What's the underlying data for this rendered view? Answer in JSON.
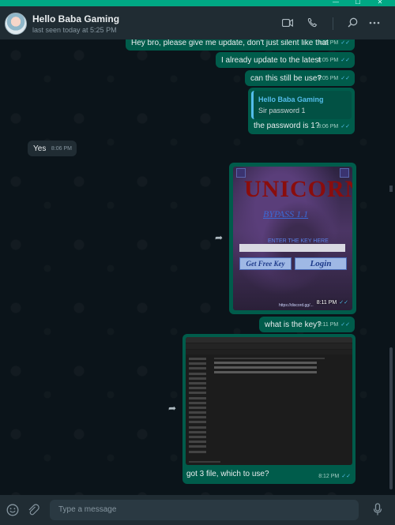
{
  "window": {
    "minimize_glyph": "—",
    "maximize_glyph": "☐",
    "close_glyph": "✕"
  },
  "header": {
    "contact_name": "Hello Baba Gaming",
    "status": "last seen today at 5:25 PM",
    "icons": [
      "video-call-icon",
      "voice-call-icon",
      "search-icon",
      "menu-icon"
    ]
  },
  "messages": [
    {
      "dir": "out",
      "text": "Hey bro, please give me update, don't just silent like that",
      "time": "8:05 PM"
    },
    {
      "dir": "out",
      "text": "I already update to the latest",
      "time": "8:05 PM"
    },
    {
      "dir": "out",
      "text": "can this still be use?",
      "time": "8:05 PM"
    },
    {
      "dir": "out",
      "quote_name": "Hello Baba Gaming",
      "quote_text": "Sir password 1",
      "text": "the password is 1?",
      "time": "8:06 PM"
    },
    {
      "dir": "in",
      "text": "Yes",
      "time": "8:06 PM"
    },
    {
      "dir": "out",
      "type": "image",
      "time": "8:11 PM",
      "image_text": {
        "title": "UNICORN",
        "subtitle": "BYPASS 1.1",
        "enter_label": "ENTER THE KEY HERE",
        "get_key": "Get Free Key",
        "login": "Login",
        "link": "https://discord.gg/..."
      }
    },
    {
      "dir": "out",
      "text": "what is the key?",
      "time": "8:11 PM"
    },
    {
      "dir": "out",
      "type": "image",
      "caption": "got 3 file, which to use?",
      "time": "8:12 PM"
    }
  ],
  "composer": {
    "placeholder": "Type a message",
    "icons": [
      "emoji-icon",
      "attach-icon",
      "mic-icon"
    ]
  },
  "colors": {
    "accent": "#00a884",
    "outgoing_bubble": "#005c4b",
    "incoming_bubble": "#202c33",
    "read_tick": "#53bdeb"
  }
}
